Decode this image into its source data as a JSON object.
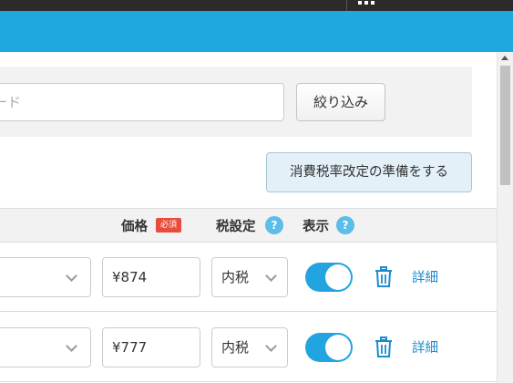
{
  "filter": {
    "keyword_placeholder": "ード",
    "filter_button": "絞り込み"
  },
  "tax_button": "消費税率改定の準備をする",
  "table": {
    "headers": {
      "price": "価格",
      "required_badge": "必須",
      "tax_setting": "税設定",
      "display": "表示",
      "help_glyph": "?"
    },
    "rows": [
      {
        "price": "¥874",
        "tax": "内税",
        "visible": true,
        "detail": "詳細"
      },
      {
        "price": "¥777",
        "tax": "内税",
        "visible": true,
        "detail": "詳細"
      }
    ]
  },
  "colors": {
    "header_bar": "#1fa8e0",
    "toggle_on": "#22a4e0",
    "required_badge": "#e74c3c",
    "help_icon": "#5bbde8",
    "link": "#1a8ccf"
  },
  "icons": [
    "apps-grid-icon",
    "chevron-down-icon",
    "help-icon",
    "trash-icon",
    "scroll-up-arrow-icon"
  ]
}
